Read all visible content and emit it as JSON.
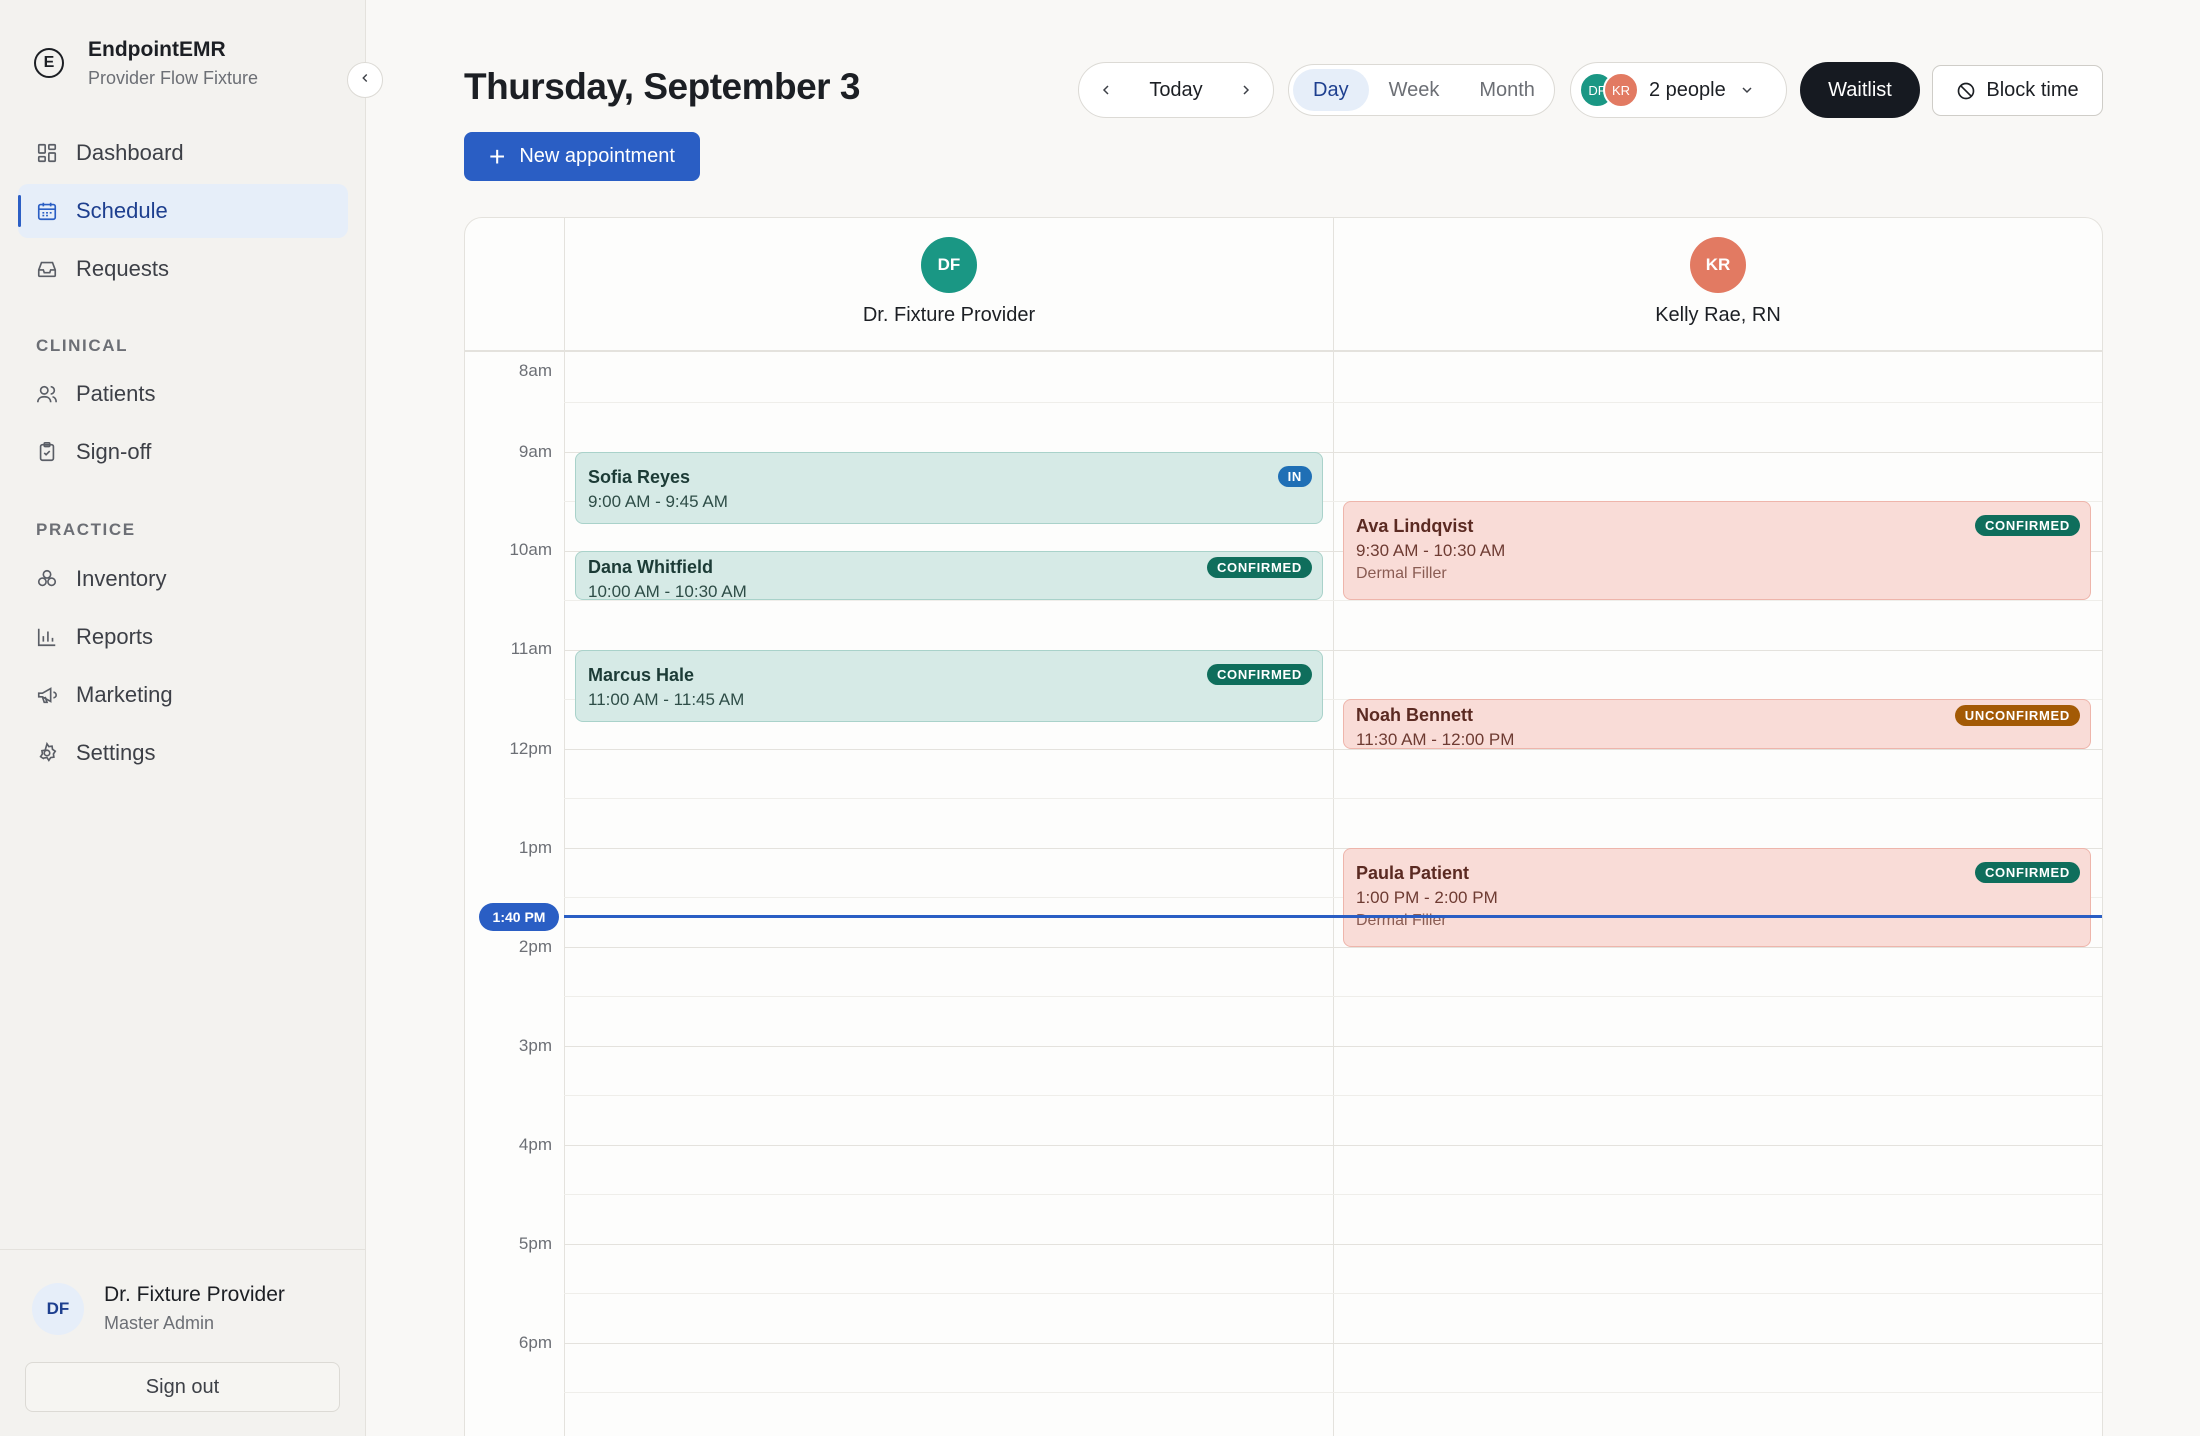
{
  "brand": {
    "name": "EndpointEMR",
    "subtitle": "Provider Flow Fixture"
  },
  "nav": {
    "primary": [
      {
        "label": "Dashboard",
        "icon": "dashboard-icon"
      },
      {
        "label": "Schedule",
        "icon": "calendar-icon",
        "active": true
      },
      {
        "label": "Requests",
        "icon": "inbox-icon"
      }
    ],
    "clinical_label": "CLINICAL",
    "clinical": [
      {
        "label": "Patients",
        "icon": "users-icon"
      },
      {
        "label": "Sign-off",
        "icon": "clipboard-check-icon"
      }
    ],
    "practice_label": "PRACTICE",
    "practice": [
      {
        "label": "Inventory",
        "icon": "boxes-icon"
      },
      {
        "label": "Reports",
        "icon": "bar-chart-icon"
      },
      {
        "label": "Marketing",
        "icon": "megaphone-icon"
      },
      {
        "label": "Settings",
        "icon": "gear-icon"
      }
    ]
  },
  "user": {
    "initials": "DF",
    "name": "Dr. Fixture Provider",
    "role": "Master Admin",
    "signout_label": "Sign out"
  },
  "header": {
    "title": "Thursday, September 3",
    "new_appointment_label": "New appointment",
    "today_label": "Today",
    "views": [
      "Day",
      "Week",
      "Month"
    ],
    "active_view": "Day",
    "people_label": "2 people",
    "people_avatars": [
      "DF",
      "KR"
    ],
    "waitlist_label": "Waitlist",
    "block_time_label": "Block time"
  },
  "calendar": {
    "hours": [
      "8am",
      "9am",
      "10am",
      "11am",
      "12pm",
      "1pm",
      "2pm",
      "3pm",
      "4pm",
      "5pm",
      "6pm"
    ],
    "now_label": "1:40 PM",
    "providers": [
      {
        "initials": "DF",
        "name": "Dr. Fixture Provider",
        "color": "#1a9784",
        "appointments": [
          {
            "name": "Sofia Reyes",
            "time": "9:00 AM - 9:45 AM",
            "status": "IN",
            "status_color": "#1f6fb5"
          },
          {
            "name": "Dana Whitfield",
            "time": "10:00 AM - 10:30 AM",
            "status": "CONFIRMED",
            "status_color": "#0f6e5c"
          },
          {
            "name": "Marcus Hale",
            "time": "11:00 AM - 11:45 AM",
            "status": "CONFIRMED",
            "status_color": "#0f6e5c"
          }
        ]
      },
      {
        "initials": "KR",
        "name": "Kelly Rae, RN",
        "color": "#e27a62",
        "appointments": [
          {
            "name": "Ava Lindqvist",
            "time": "9:30 AM - 10:30 AM",
            "service": "Dermal Filler",
            "status": "CONFIRMED",
            "status_color": "#0f6e5c"
          },
          {
            "name": "Noah Bennett",
            "time": "11:30 AM - 12:00 PM",
            "status": "UNCONFIRMED",
            "status_color": "#a35a05"
          },
          {
            "name": "Paula Patient",
            "time": "1:00 PM - 2:00 PM",
            "service": "Dermal Filler",
            "status": "CONFIRMED",
            "status_color": "#0f6e5c"
          }
        ]
      }
    ]
  }
}
